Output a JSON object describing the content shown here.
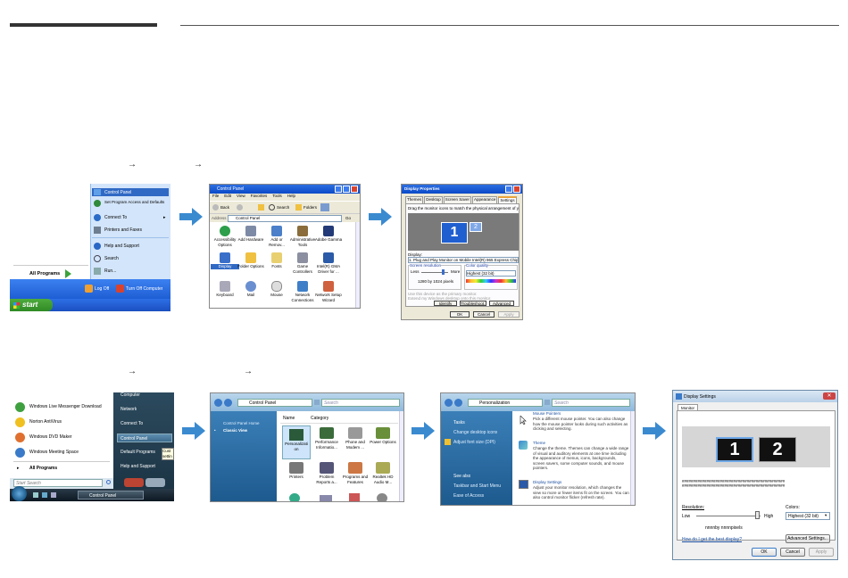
{
  "arrows": {
    "glyph": "→"
  },
  "xp_start": {
    "items": [
      "Control Panel",
      "Set Program Access and Defaults",
      "Connect To",
      "Printers and Faxes",
      "Help and Support",
      "Search",
      "Run..."
    ],
    "all_programs": "All Programs",
    "log_off": "Log Off",
    "turn_off": "Turn Off Computer",
    "start": "start"
  },
  "xp_cp": {
    "title": "Control Panel",
    "menu": [
      "File",
      "Edit",
      "View",
      "Favorites",
      "Tools",
      "Help"
    ],
    "back": "Back",
    "search": "Search",
    "folders": "Folders",
    "address_label": "Address",
    "address": "Control Panel",
    "go": "Go",
    "icons": [
      "Accessibility Options",
      "Add Hardware",
      "Add or Remov...",
      "Administrative Tools",
      "Adobe Gamma",
      "Display",
      "Folder Options",
      "Fonts",
      "Game Controllers",
      "Intel(R) GMA Driver for ...",
      "Keyboard",
      "Mail",
      "Mouse",
      "Network Connections",
      "Network Setup Wizard"
    ]
  },
  "xp_display": {
    "title": "Display Properties",
    "tabs": [
      "Themes",
      "Desktop",
      "Screen Saver",
      "Appearance",
      "Settings"
    ],
    "instruction": "Drag the monitor icons to match the physical arrangement of your monitors.",
    "monitor1": "1",
    "monitor2": "2",
    "display_label": "Display:",
    "display_value": "1. Plug and Play Monitor on Mobile Intel(R) 965 Express Chipset Family",
    "res_label": "Screen resolution",
    "less": "Less",
    "more": "More",
    "res_value": "1280 by 1024 pixels",
    "quality_label": "Color quality",
    "quality_value": "Highest (32 bit)",
    "check1": "Use this device as the primary monitor.",
    "check2": "Extend my Windows desktop onto this monitor.",
    "identify": "Identify",
    "troubleshoot": "Troubleshoot...",
    "advanced": "Advanced",
    "ok": "OK",
    "cancel": "Cancel",
    "apply": "Apply"
  },
  "vista_start": {
    "programs": [
      "Windows Live Messenger Download",
      "Norton AntiVirus",
      "Windows DVD Maker",
      "Windows Meeting Space"
    ],
    "all_programs": "All Programs",
    "right": [
      "Computer",
      "Network",
      "Connect To",
      "Control Panel",
      "Default Programs",
      "Help and Support"
    ],
    "search": "Start Search",
    "tooltip": "Cust settin",
    "taskbar": "Control Panel"
  },
  "vista_cp": {
    "address": "Control Panel",
    "search": "Search",
    "nav_home": "Control Panel Home",
    "nav_classic": "Classic View",
    "col_name": "Name",
    "col_category": "Category",
    "icons": [
      "Personalizati on",
      "Performance Informatio...",
      "Phone and Modem ...",
      "Power Options",
      "Printers",
      "Problem Reports a...",
      "Programs and Features",
      "Realtek HD Audio M..."
    ]
  },
  "vista_pers": {
    "address": "Personalization",
    "search": "Search",
    "tasks": "Tasks",
    "task1": "Change desktop icons",
    "task2": "Adjust font size (DPI)",
    "see_also": "See also",
    "see1": "Taskbar and Start Menu",
    "see2": "Ease of Access",
    "mouse_title": "Mouse Pointers",
    "mouse_text": "Pick a different mouse pointer. You can also change how the mouse pointer looks during such activities as clicking and selecting.",
    "theme_title": "Theme",
    "theme_text": "Change the theme. Themes can change a wide range of visual and auditory elements at one time including the appearance of menus, icons, backgrounds, screen savers, some computer sounds, and mouse pointers.",
    "display_title": "Display Settings",
    "display_text": "Adjust your monitor resolution, which changes the view so more or fewer items fit on the screen. You can also control monitor flicker (refresh rate)."
  },
  "vista_ds": {
    "title": "Display Settings",
    "tab": "Monitor",
    "m1": "1",
    "m2": "2",
    "hash1": "##############################################",
    "hash2": "##############################################",
    "resolution": "Resolution:",
    "low": "Low",
    "high": "High",
    "res_value": "nnnnby nnnnpixels",
    "colors": "Colors:",
    "colors_value": "Highest (32 bit)",
    "help_link": "How do I get the best display?",
    "advanced": "Advanced Settings...",
    "ok": "OK",
    "cancel": "Cancel",
    "apply": "Apply"
  }
}
